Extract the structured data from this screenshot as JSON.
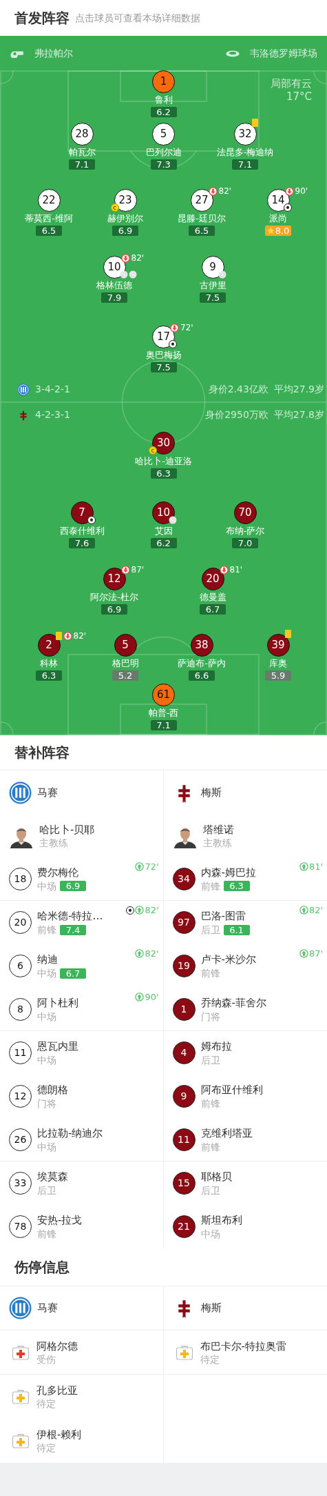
{
  "starting": {
    "title": "首发阵容",
    "hint": "点击球员可查看本场详细数据"
  },
  "match_info": {
    "referee": "弗拉帕尔",
    "stadium": "韦洛德罗姆球场",
    "weather": "局部有云",
    "temperature": "17°C"
  },
  "lineups": [
    {
      "kind": "home",
      "formation": "3-4-2-1",
      "value": "身价2.43亿欧",
      "avg_age": "平均27.9岁",
      "lines": [
        [
          {
            "number": "1",
            "name": "鲁利",
            "rating": {
              "value": "6.2",
              "kind": "normal"
            },
            "keeper": true
          }
        ],
        [
          {
            "number": "28",
            "name": "帕瓦尔",
            "rating": {
              "value": "7.1",
              "kind": "normal"
            }
          },
          {
            "number": "5",
            "name": "巴列尔迪",
            "rating": {
              "value": "7.3",
              "kind": "normal"
            }
          },
          {
            "number": "32",
            "name": "法昆多-梅迪纳",
            "rating": {
              "value": "7.1",
              "kind": "normal"
            },
            "events": [
              {
                "kind": "yellow_card"
              }
            ]
          }
        ],
        [
          {
            "number": "22",
            "name": "蒂莫西-维阿",
            "rating": {
              "value": "6.5",
              "kind": "normal"
            }
          },
          {
            "number": "23",
            "name": "赫伊别尔",
            "rating": {
              "value": "6.9",
              "kind": "normal"
            },
            "events": [
              {
                "kind": "captain",
                "text": "c"
              }
            ]
          },
          {
            "number": "27",
            "name": "昆滕-廷贝尔",
            "rating": {
              "value": "6.5",
              "kind": "normal"
            },
            "events": [
              {
                "kind": "sub_off",
                "minute": "82'"
              }
            ]
          },
          {
            "number": "14",
            "name": "派尚",
            "rating": {
              "value": "8.0",
              "kind": "best"
            },
            "events": [
              {
                "kind": "sub_off",
                "minute": "90'"
              },
              {
                "kind": "goal"
              }
            ]
          }
        ],
        [
          {
            "number": "10",
            "name": "格林伍德",
            "rating": {
              "value": "7.9",
              "kind": "normal"
            },
            "events": [
              {
                "kind": "sub_off",
                "minute": "82'"
              },
              {
                "kind": "assist"
              },
              {
                "kind": "assist"
              }
            ]
          },
          {
            "number": "9",
            "name": "古伊里",
            "rating": {
              "value": "7.5",
              "kind": "normal"
            },
            "events": [
              {
                "kind": "assist"
              }
            ]
          }
        ],
        [
          {
            "number": "17",
            "name": "奥巴梅扬",
            "rating": {
              "value": "7.5",
              "kind": "normal"
            },
            "events": [
              {
                "kind": "sub_off",
                "minute": "72'"
              },
              {
                "kind": "goal"
              }
            ]
          }
        ]
      ]
    },
    {
      "kind": "away",
      "formation": "4-2-3-1",
      "value": "身价2950万欧",
      "avg_age": "平均27.8岁",
      "lines": [
        [
          {
            "number": "30",
            "name": "哈比卜-迪亚洛",
            "rating": {
              "value": "6.3",
              "kind": "normal"
            },
            "events": [
              {
                "kind": "captain",
                "text": "c"
              }
            ]
          }
        ],
        [
          {
            "number": "7",
            "name": "西泰什维利",
            "rating": {
              "value": "7.6",
              "kind": "normal"
            },
            "events": [
              {
                "kind": "goal"
              }
            ]
          },
          {
            "number": "10",
            "name": "艾因",
            "rating": {
              "value": "6.2",
              "kind": "normal"
            },
            "events": [
              {
                "kind": "assist"
              }
            ]
          },
          {
            "number": "70",
            "name": "布纳-萨尔",
            "rating": {
              "value": "7.0",
              "kind": "normal"
            }
          }
        ],
        [
          {
            "number": "12",
            "name": "阿尔法-杜尔",
            "rating": {
              "value": "6.9",
              "kind": "normal"
            },
            "events": [
              {
                "kind": "sub_off",
                "minute": "87'"
              }
            ]
          },
          {
            "number": "20",
            "name": "德曼盖",
            "rating": {
              "value": "6.7",
              "kind": "normal"
            },
            "events": [
              {
                "kind": "sub_off",
                "minute": "81'"
              }
            ]
          }
        ],
        [
          {
            "number": "2",
            "name": "科林",
            "rating": {
              "value": "6.3",
              "kind": "normal"
            },
            "events": [
              {
                "kind": "yellow_card"
              },
              {
                "kind": "sub_off",
                "minute": "82'"
              }
            ]
          },
          {
            "number": "5",
            "name": "格巴明",
            "rating": {
              "value": "5.2",
              "kind": "low"
            }
          },
          {
            "number": "38",
            "name": "萨迪布-萨内",
            "rating": {
              "value": "6.6",
              "kind": "normal"
            }
          },
          {
            "number": "39",
            "name": "库奥",
            "rating": {
              "value": "5.9",
              "kind": "low"
            },
            "events": [
              {
                "kind": "yellow_card"
              }
            ]
          }
        ],
        [
          {
            "number": "61",
            "name": "帕普-西",
            "rating": {
              "value": "7.1",
              "kind": "normal"
            },
            "keeper": true
          }
        ]
      ]
    }
  ],
  "subs": {
    "title": "替补阵容",
    "teams": [
      {
        "kind": "home",
        "name": "马赛",
        "coach": {
          "name": "哈比卜-贝耶",
          "role": "主教练"
        },
        "players": [
          {
            "number": "18",
            "name": "费尔梅伦",
            "position": "中场",
            "rating": "6.9",
            "sub_on": "72'"
          },
          {
            "number": "20",
            "name": "哈米德-特拉…",
            "position": "前锋",
            "rating": "7.4",
            "sub_on": "82'",
            "goal": true
          },
          {
            "number": "6",
            "name": "纳迪",
            "position": "中场",
            "rating": "6.7",
            "sub_on": "82'"
          },
          {
            "number": "8",
            "name": "阿卜杜利",
            "position": "中场",
            "sub_on": "90'"
          },
          {
            "number": "11",
            "name": "恩瓦内里",
            "position": "中场"
          },
          {
            "number": "12",
            "name": "德朗格",
            "position": "门将"
          },
          {
            "number": "26",
            "name": "比拉勒-纳迪尔",
            "position": "中场"
          },
          {
            "number": "33",
            "name": "埃莫森",
            "position": "后卫"
          },
          {
            "number": "78",
            "name": "安热-拉戈",
            "position": "前锋"
          }
        ]
      },
      {
        "kind": "away",
        "name": "梅斯",
        "coach": {
          "name": "塔维诺",
          "role": "主教练"
        },
        "players": [
          {
            "number": "34",
            "name": "内森-姆巴拉",
            "position": "前锋",
            "rating": "6.3",
            "sub_on": "81'"
          },
          {
            "number": "97",
            "name": "巴洛-图雷",
            "position": "后卫",
            "rating": "6.1",
            "sub_on": "82'"
          },
          {
            "number": "19",
            "name": "卢卡-米沙尔",
            "position": "前锋",
            "sub_on": "87'"
          },
          {
            "number": "1",
            "name": "乔纳森-菲舍尔",
            "position": "门将"
          },
          {
            "number": "4",
            "name": "姆布拉",
            "position": "后卫"
          },
          {
            "number": "9",
            "name": "阿布亚什维利",
            "position": "前锋"
          },
          {
            "number": "11",
            "name": "克维利塔亚",
            "position": "前锋"
          },
          {
            "number": "15",
            "name": "耶格贝",
            "position": "后卫"
          },
          {
            "number": "21",
            "name": "斯坦布利",
            "position": "中场"
          }
        ]
      }
    ]
  },
  "injuries": {
    "title": "伤停信息",
    "teams": [
      {
        "kind": "home",
        "name": "马赛",
        "players": [
          {
            "name": "阿格尔德",
            "status": "受伤",
            "kind": "injured"
          },
          {
            "name": "孔多比亚",
            "status": "待定",
            "kind": "doubtful"
          },
          {
            "name": "伊根-赖利",
            "status": "待定",
            "kind": "doubtful"
          }
        ]
      },
      {
        "kind": "away",
        "name": "梅斯",
        "players": [
          {
            "name": "布巴卡尔-特拉奥雷",
            "status": "待定",
            "kind": "doubtful"
          }
        ]
      }
    ]
  }
}
